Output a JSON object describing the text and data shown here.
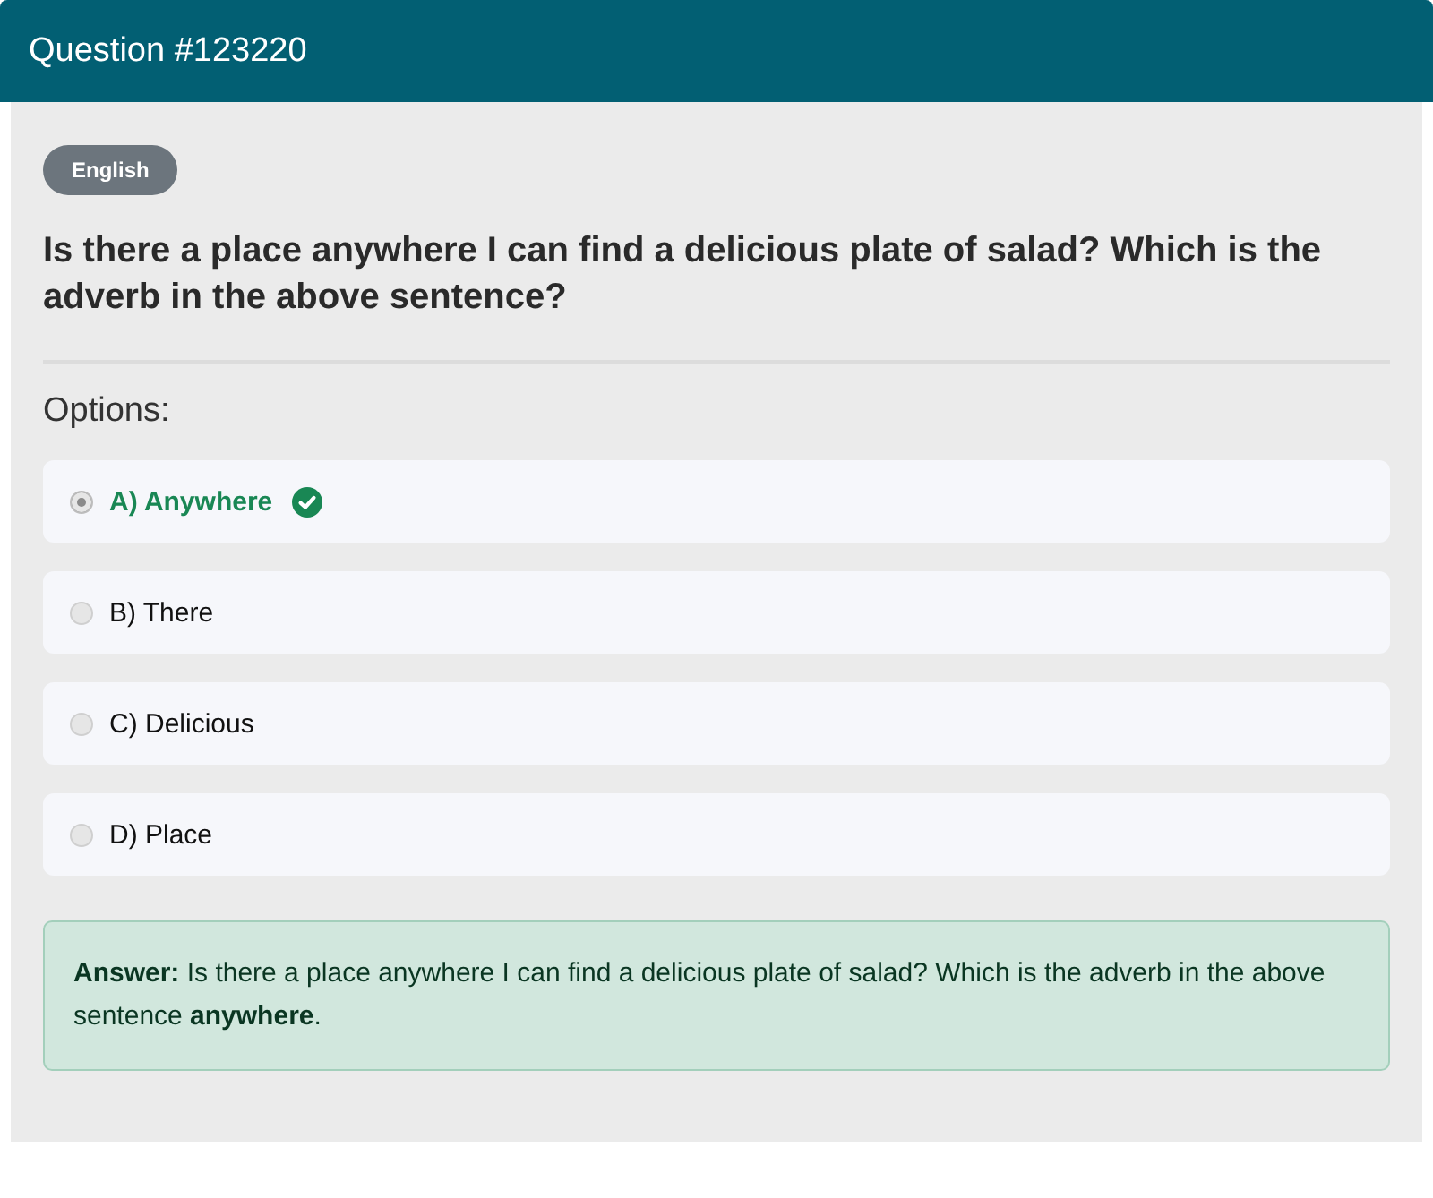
{
  "header": {
    "title": "Question #123220"
  },
  "badge": "English",
  "question": "Is there a place anywhere I can find a delicious plate of salad? Which is the adverb in the above sentence?",
  "options_label": "Options:",
  "options": [
    {
      "label": "A) Anywhere",
      "selected": true,
      "correct": true
    },
    {
      "label": "B) There",
      "selected": false,
      "correct": false
    },
    {
      "label": "C) Delicious",
      "selected": false,
      "correct": false
    },
    {
      "label": "D) Place",
      "selected": false,
      "correct": false
    }
  ],
  "answer": "**Answer:** Is there a place anywhere I can find a delicious plate of salad? Which is the adverb in the above sentence **anywhere**."
}
